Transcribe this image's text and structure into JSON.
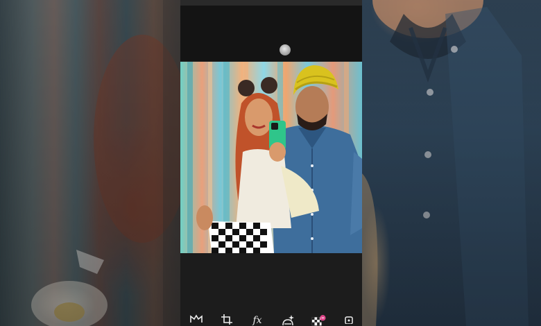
{
  "editor": {
    "state": "loading",
    "loading_indicator": "spinner-dot"
  },
  "toolbar": {
    "tools": [
      {
        "id": "mask",
        "icon": "mask-icon"
      },
      {
        "id": "crop",
        "icon": "crop-icon"
      },
      {
        "id": "effects",
        "icon": "fx-icon",
        "label": "fx"
      },
      {
        "id": "magic",
        "icon": "magic-brush-icon"
      },
      {
        "id": "sticker",
        "icon": "checker-sticker-icon"
      },
      {
        "id": "more",
        "icon": "overflow-icon"
      }
    ]
  },
  "colors": {
    "toolbar_bg": "#1c1c1c",
    "turban": "#d9c21e",
    "shirt": "#3e6e9c",
    "hair": "#c0522a",
    "sticker_badge": "#e0468a"
  }
}
